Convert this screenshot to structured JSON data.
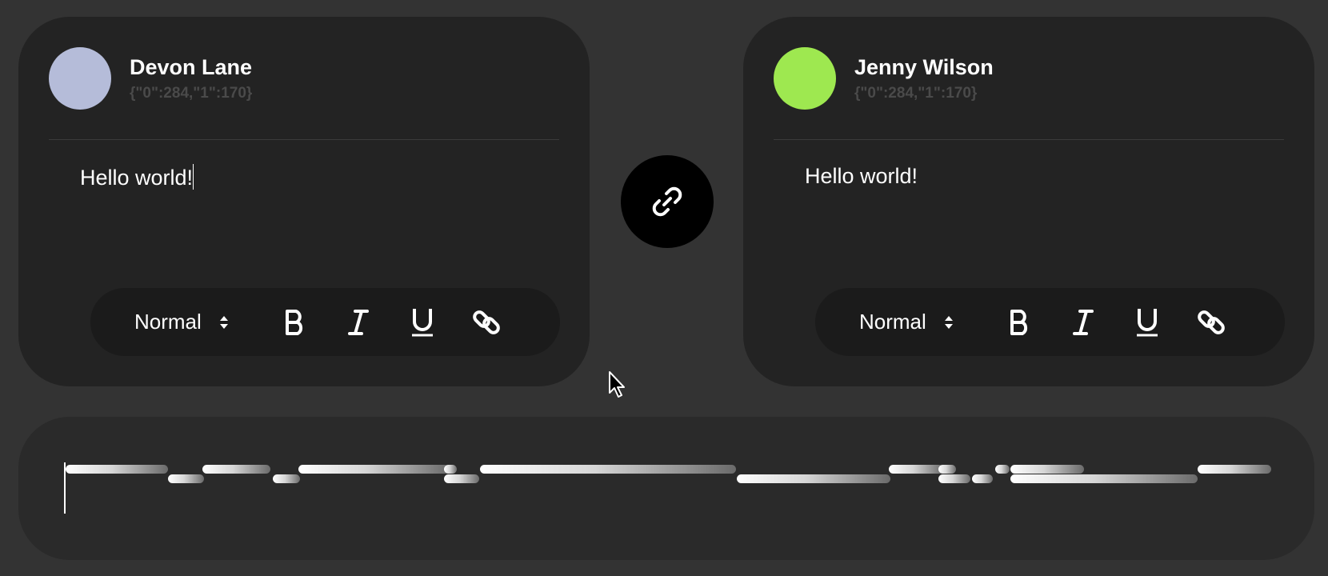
{
  "users": [
    {
      "name": "Devon Lane",
      "position_text": "{\"0\":284,\"1\":170}",
      "avatar_color": "#b5bcd9",
      "editor_text": "Hello world!",
      "format_select": "Normal"
    },
    {
      "name": "Jenny Wilson",
      "position_text": "{\"0\":284,\"1\":170}",
      "avatar_color": "#9ee850",
      "editor_text": "Hello world!",
      "format_select": "Normal"
    }
  ],
  "toolbar": {
    "bold_icon": "bold-icon",
    "italic_icon": "italic-icon",
    "underline_icon": "underline-icon",
    "link_icon": "link-icon",
    "select_arrows_icon": "select-arrows-icon"
  },
  "link_button": {
    "icon": "link-icon",
    "color": "#000000"
  },
  "timeline": {
    "playhead_position": 0
  }
}
